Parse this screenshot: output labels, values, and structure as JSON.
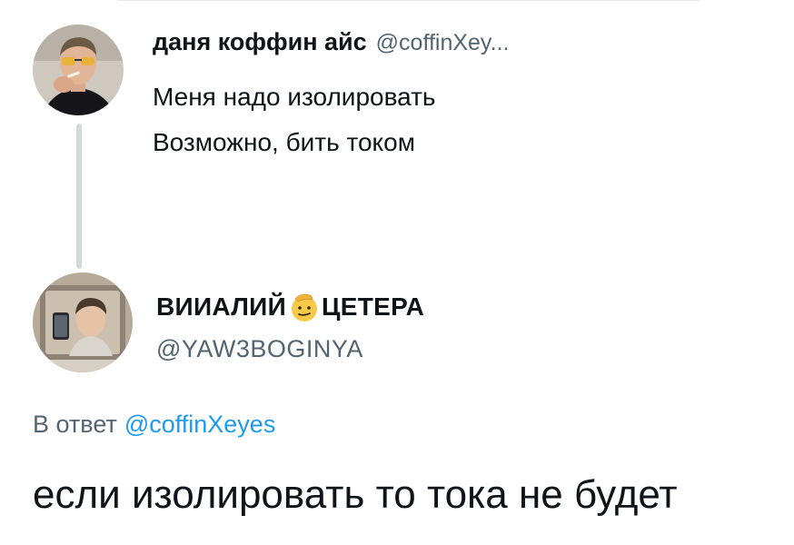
{
  "parent_tweet": {
    "display_name": "даня коффин айс",
    "handle": "@coffinXey...",
    "lines": [
      "Меня надо изолировать",
      "Возможно, бить током"
    ],
    "avatar_icon": "avatar-man-sunglasses-cigarette"
  },
  "reply_tweet": {
    "display_name_part1": "ВИИАЛИЙ",
    "display_name_part2": "ЦЕТЕРА",
    "name_emoji": "salute-face-emoji",
    "handle": "@YAW3BOGINYA",
    "reply_prefix": "В ответ",
    "reply_mention": "@coffinXeyes",
    "text": "если изолировать то тока не будет",
    "avatar_icon": "avatar-mirror-selfie"
  },
  "colors": {
    "text": "#0f1419",
    "secondary": "#536471",
    "link": "#1d9bf0",
    "thread_line": "#cfd9de"
  }
}
